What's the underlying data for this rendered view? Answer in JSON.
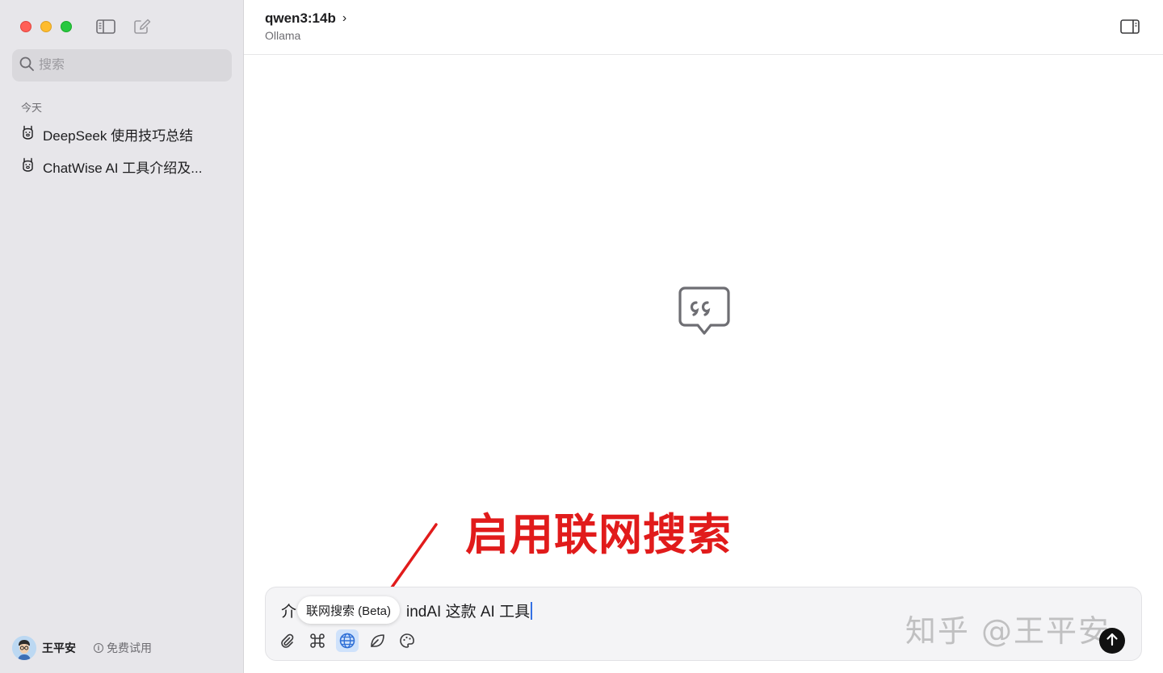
{
  "sidebar": {
    "search_placeholder": "搜索",
    "section_today": "今天",
    "conversations": [
      {
        "title": "DeepSeek 使用技巧总结",
        "icon": "llama-icon"
      },
      {
        "title": "ChatWise AI 工具介绍及...",
        "icon": "llama-icon"
      }
    ],
    "user": {
      "name": "王平安",
      "trial_label": "免费试用",
      "info_glyph": "i"
    }
  },
  "header": {
    "model": "qwen3:14b",
    "chevron": "›",
    "provider": "Ollama"
  },
  "annotation": {
    "text": "启用联网搜索",
    "color": "#e11b1b"
  },
  "composer": {
    "visible_text_start": "介",
    "visible_text_end": "indAI 这款 AI 工具",
    "tooltip": "联网搜索 (Beta)",
    "watermark": "知乎 @王平安",
    "tools": [
      {
        "name": "attachment-icon"
      },
      {
        "name": "command-icon"
      },
      {
        "name": "globe-icon",
        "active": true
      },
      {
        "name": "leaf-icon"
      },
      {
        "name": "palette-icon"
      }
    ],
    "send_icon": "arrow-up-icon"
  },
  "colors": {
    "sidebar_bg": "#e7e6ea",
    "accent_blue": "#3470e4",
    "active_tool_bg": "#cfe2fb"
  }
}
